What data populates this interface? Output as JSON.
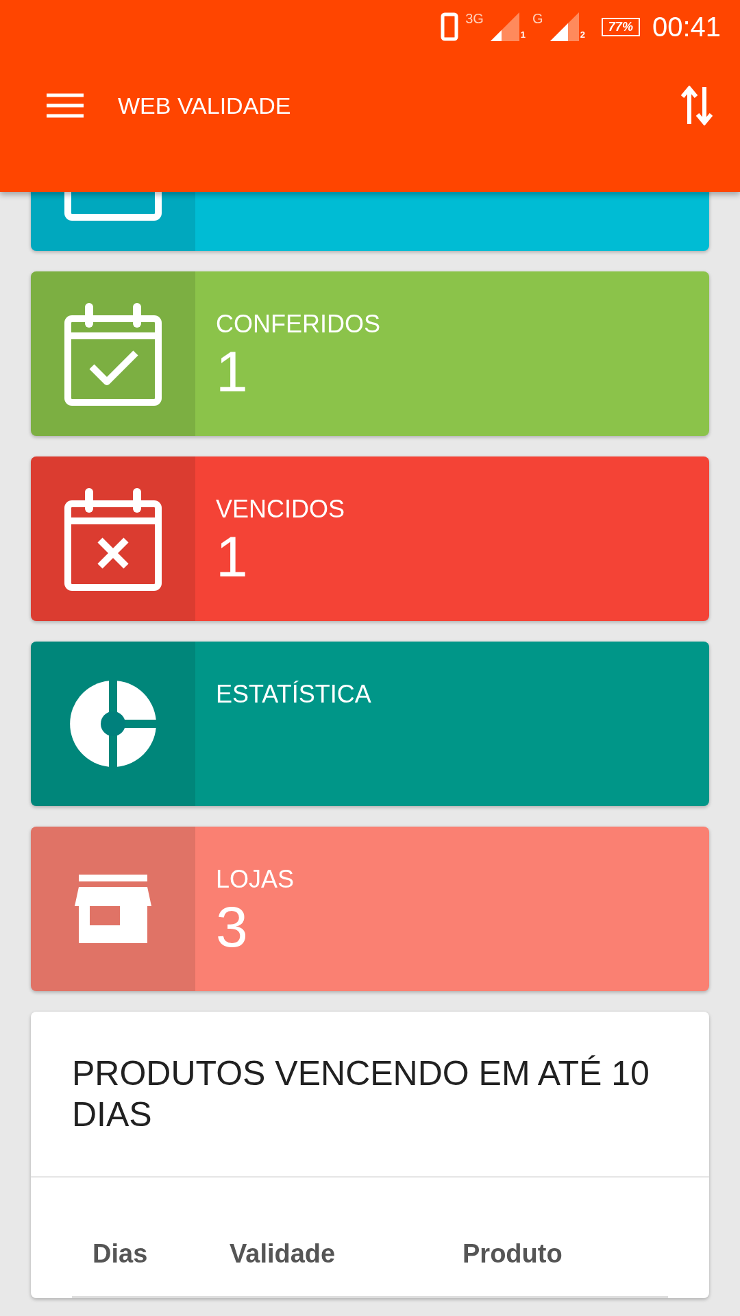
{
  "status_bar": {
    "network_1": "3G",
    "sim_1": "1",
    "network_2": "G",
    "sim_2": "2",
    "battery": "77%",
    "time": "00:41"
  },
  "app_bar": {
    "title": "WEB VALIDADE"
  },
  "cards": [
    {
      "kind": "calendar",
      "color": "#00bcd4"
    },
    {
      "kind": "check",
      "label": "CONFERIDOS",
      "value": "1",
      "color": "#8bc34a"
    },
    {
      "kind": "cross",
      "label": "VENCIDOS",
      "value": "1",
      "color": "#f44336"
    },
    {
      "kind": "chart",
      "label": "ESTATÍSTICA",
      "color": "#009688"
    },
    {
      "kind": "store",
      "label": "LOJAS",
      "value": "3",
      "color": "#fa8072"
    }
  ],
  "expiring": {
    "title": "PRODUTOS VENCENDO EM ATÉ 10 DIAS",
    "columns": [
      "Dias",
      "Validade",
      "Produto"
    ]
  }
}
